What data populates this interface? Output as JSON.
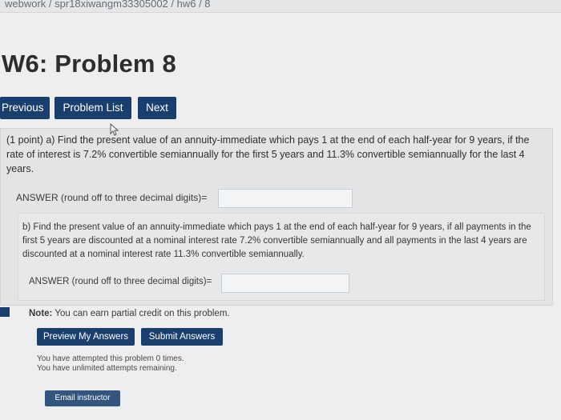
{
  "breadcrumb": "webwork / spr18xiwangm33305002 / hw6 / 8",
  "page_title": "W6: Problem 8",
  "nav": {
    "previous": "Previous",
    "problem_list": "Problem List",
    "next": "Next"
  },
  "problem": {
    "part_a_text": "(1 point) a) Find the present value of an annuity-immediate which pays 1 at the end of each half-year for 9 years, if the rate of interest is 7.2% convertible semiannually for the first 5 years and 11.3% convertible semiannually for the last 4 years.",
    "part_a_answer_label": "ANSWER (round off to three decimal digits)=",
    "part_a_answer_value": "",
    "part_b_text": "b) Find the present value of an annuity-immediate which pays 1 at the end of each half-year for 9 years, if all payments in the first 5 years are discounted at a nominal interest rate 7.2% convertible semiannually and all payments in the last 4 years are discounted at a nominal interest rate 11.3% convertible semiannually.",
    "part_b_answer_label": "ANSWER (round off to three decimal digits)=",
    "part_b_answer_value": ""
  },
  "note_label": "Note:",
  "note_text": "You can earn partial credit on this problem.",
  "actions": {
    "preview": "Preview My Answers",
    "submit": "Submit Answers"
  },
  "status": {
    "attempted": "You have attempted this problem 0 times.",
    "remaining": "You have unlimited attempts remaining."
  },
  "email_instructor": "Email instructor",
  "colors": {
    "button_bg": "#1a3f6f",
    "page_bg": "#eceef0"
  }
}
